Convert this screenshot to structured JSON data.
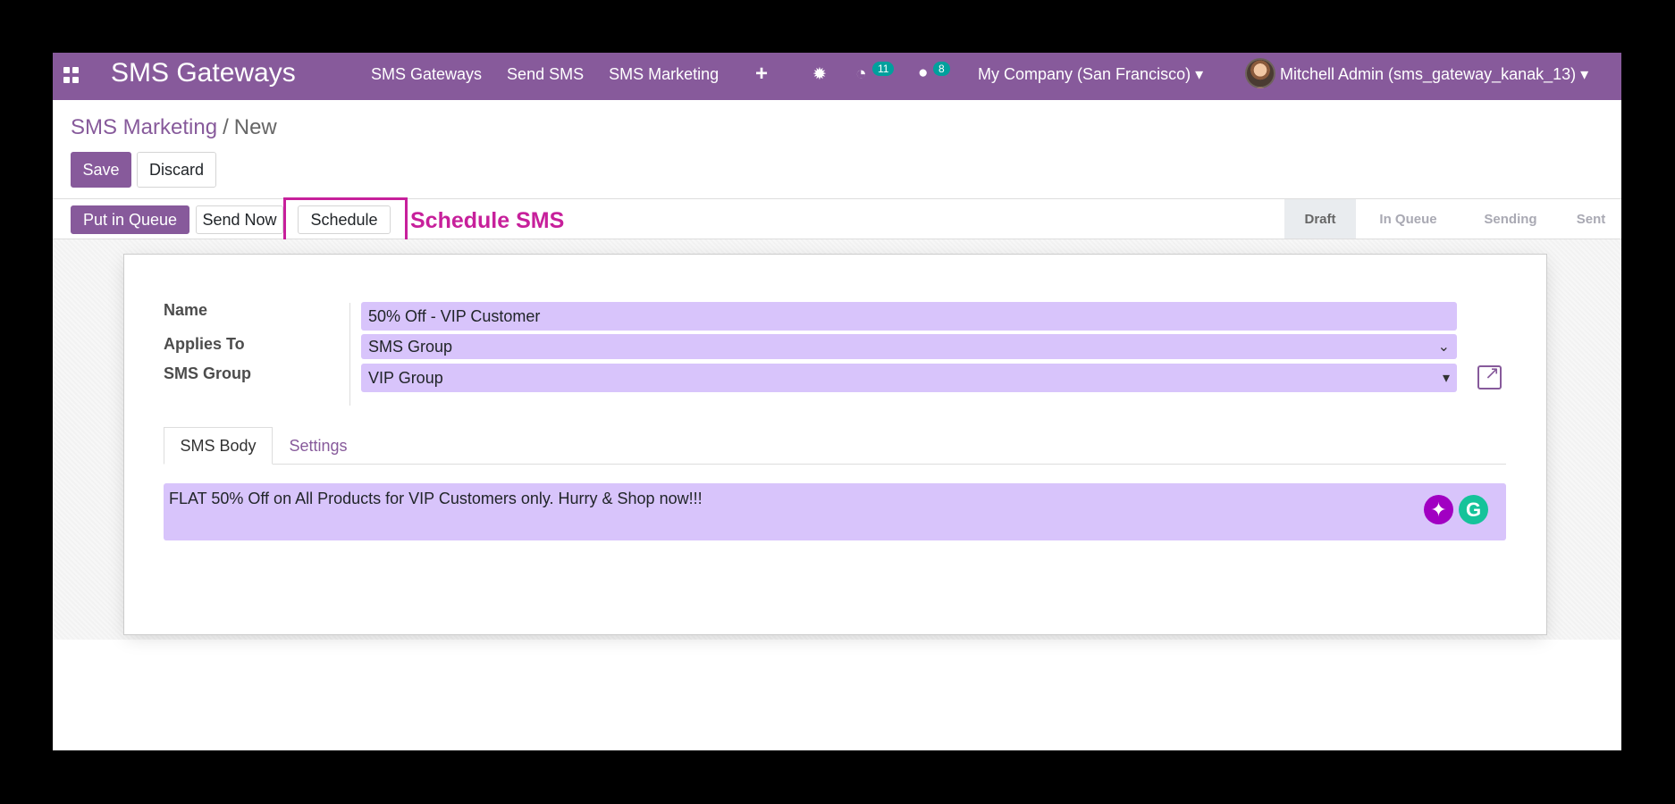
{
  "navbar": {
    "brand": "SMS Gateways",
    "menu": [
      "SMS Gateways",
      "Send SMS",
      "SMS Marketing"
    ],
    "activity_count": "11",
    "message_count": "8",
    "company": "My Company (San Francisco)",
    "user": "Mitchell Admin (sms_gateway_kanak_13)",
    "accent": "#875a9b"
  },
  "breadcrumb": {
    "parent": "SMS Marketing",
    "separator": "/",
    "current": "New"
  },
  "actions": {
    "save": "Save",
    "discard": "Discard"
  },
  "status_buttons": {
    "put_in_queue": "Put in Queue",
    "send_now": "Send Now",
    "schedule": "Schedule"
  },
  "stages": [
    "Draft",
    "In Queue",
    "Sending",
    "Sent"
  ],
  "active_stage": "Draft",
  "annotation": {
    "text": "Schedule SMS",
    "color": "#c7209b"
  },
  "form": {
    "name_label": "Name",
    "name_value": "50% Off - VIP Customer",
    "applies_label": "Applies To",
    "applies_value": "SMS Group",
    "group_label": "SMS Group",
    "group_value": "VIP Group"
  },
  "tabs": {
    "body": "SMS Body",
    "settings": "Settings"
  },
  "sms_body": "FLAT 50% Off on All Products for VIP Customers only. Hurry & Shop now!!!",
  "icons": [
    "apps-grid-icon",
    "plus-icon",
    "bug-icon",
    "clock-icon",
    "chat-icon",
    "caret-down-icon",
    "external-link-icon",
    "sparkle-icon",
    "grammarly-icon"
  ]
}
